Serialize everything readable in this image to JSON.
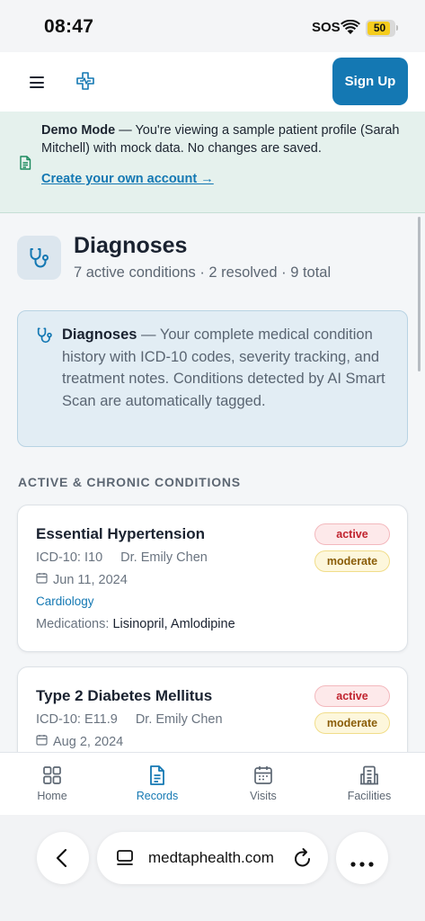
{
  "status_bar": {
    "time": "08:47",
    "sos": "SOS",
    "battery": "50"
  },
  "header": {
    "signup_label": "Sign Up"
  },
  "demo_banner": {
    "title": "Demo Mode",
    "message": " — You're viewing a sample patient profile (Sarah Mitchell) with mock data. No changes are saved.",
    "link": "Create your own account →"
  },
  "page": {
    "title": "Diagnoses",
    "subtitle": "7 active conditions · 2 resolved · 9 total"
  },
  "info": {
    "title": "Diagnoses",
    "text": " — Your complete medical condition history with ICD-10 codes, severity tracking, and treatment notes. Conditions detected by AI Smart Scan are automatically tagged."
  },
  "section_heading": "ACTIVE & CHRONIC CONDITIONS",
  "conditions": [
    {
      "name": "Essential Hypertension",
      "icd": "ICD-10: I10",
      "doctor": "Dr. Emily Chen",
      "date": "Jun 11, 2024",
      "department": "Cardiology",
      "meds_label": "Medications: ",
      "meds": "Lisinopril, Amlodipine",
      "status": "active",
      "severity": "moderate"
    },
    {
      "name": "Type 2 Diabetes Mellitus",
      "icd": "ICD-10: E11.9",
      "doctor": "Dr. Emily Chen",
      "date": "Aug 2, 2024",
      "status": "active",
      "severity": "moderate"
    }
  ],
  "bottom_nav": [
    {
      "label": "Home",
      "icon": "grid-icon"
    },
    {
      "label": "Records",
      "icon": "document-icon",
      "active": true
    },
    {
      "label": "Visits",
      "icon": "calendar-icon"
    },
    {
      "label": "Facilities",
      "icon": "building-icon"
    }
  ],
  "browser": {
    "url": "medtaphealth.com"
  },
  "colors": {
    "accent": "#1478b3",
    "banner_bg": "#e5f1ed",
    "info_bg": "#e2edf4"
  }
}
